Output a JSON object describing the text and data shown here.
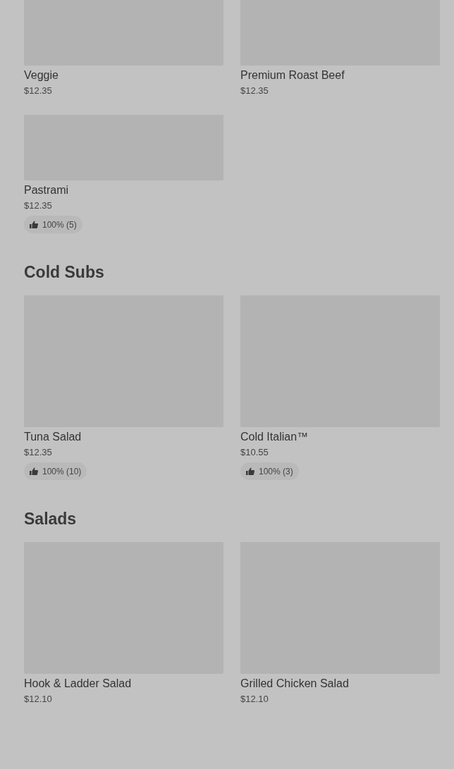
{
  "sections": [
    {
      "items": [
        {
          "name": "Veggie",
          "price": "$12.35"
        },
        {
          "name": "Premium Roast Beef",
          "price": "$12.35"
        },
        {
          "name": "Pastrami",
          "price": "$12.35",
          "rating": "100% (5)"
        }
      ]
    },
    {
      "title": "Cold Subs",
      "items": [
        {
          "name": "Tuna Salad",
          "price": "$12.35",
          "rating": "100% (10)"
        },
        {
          "name": "Cold Italian™",
          "price": "$10.55",
          "rating": "100% (3)"
        }
      ]
    },
    {
      "title": "Salads",
      "items": [
        {
          "name": "Hook & Ladder Salad",
          "price": "$12.10"
        },
        {
          "name": "Grilled Chicken Salad",
          "price": "$12.10"
        }
      ]
    }
  ]
}
